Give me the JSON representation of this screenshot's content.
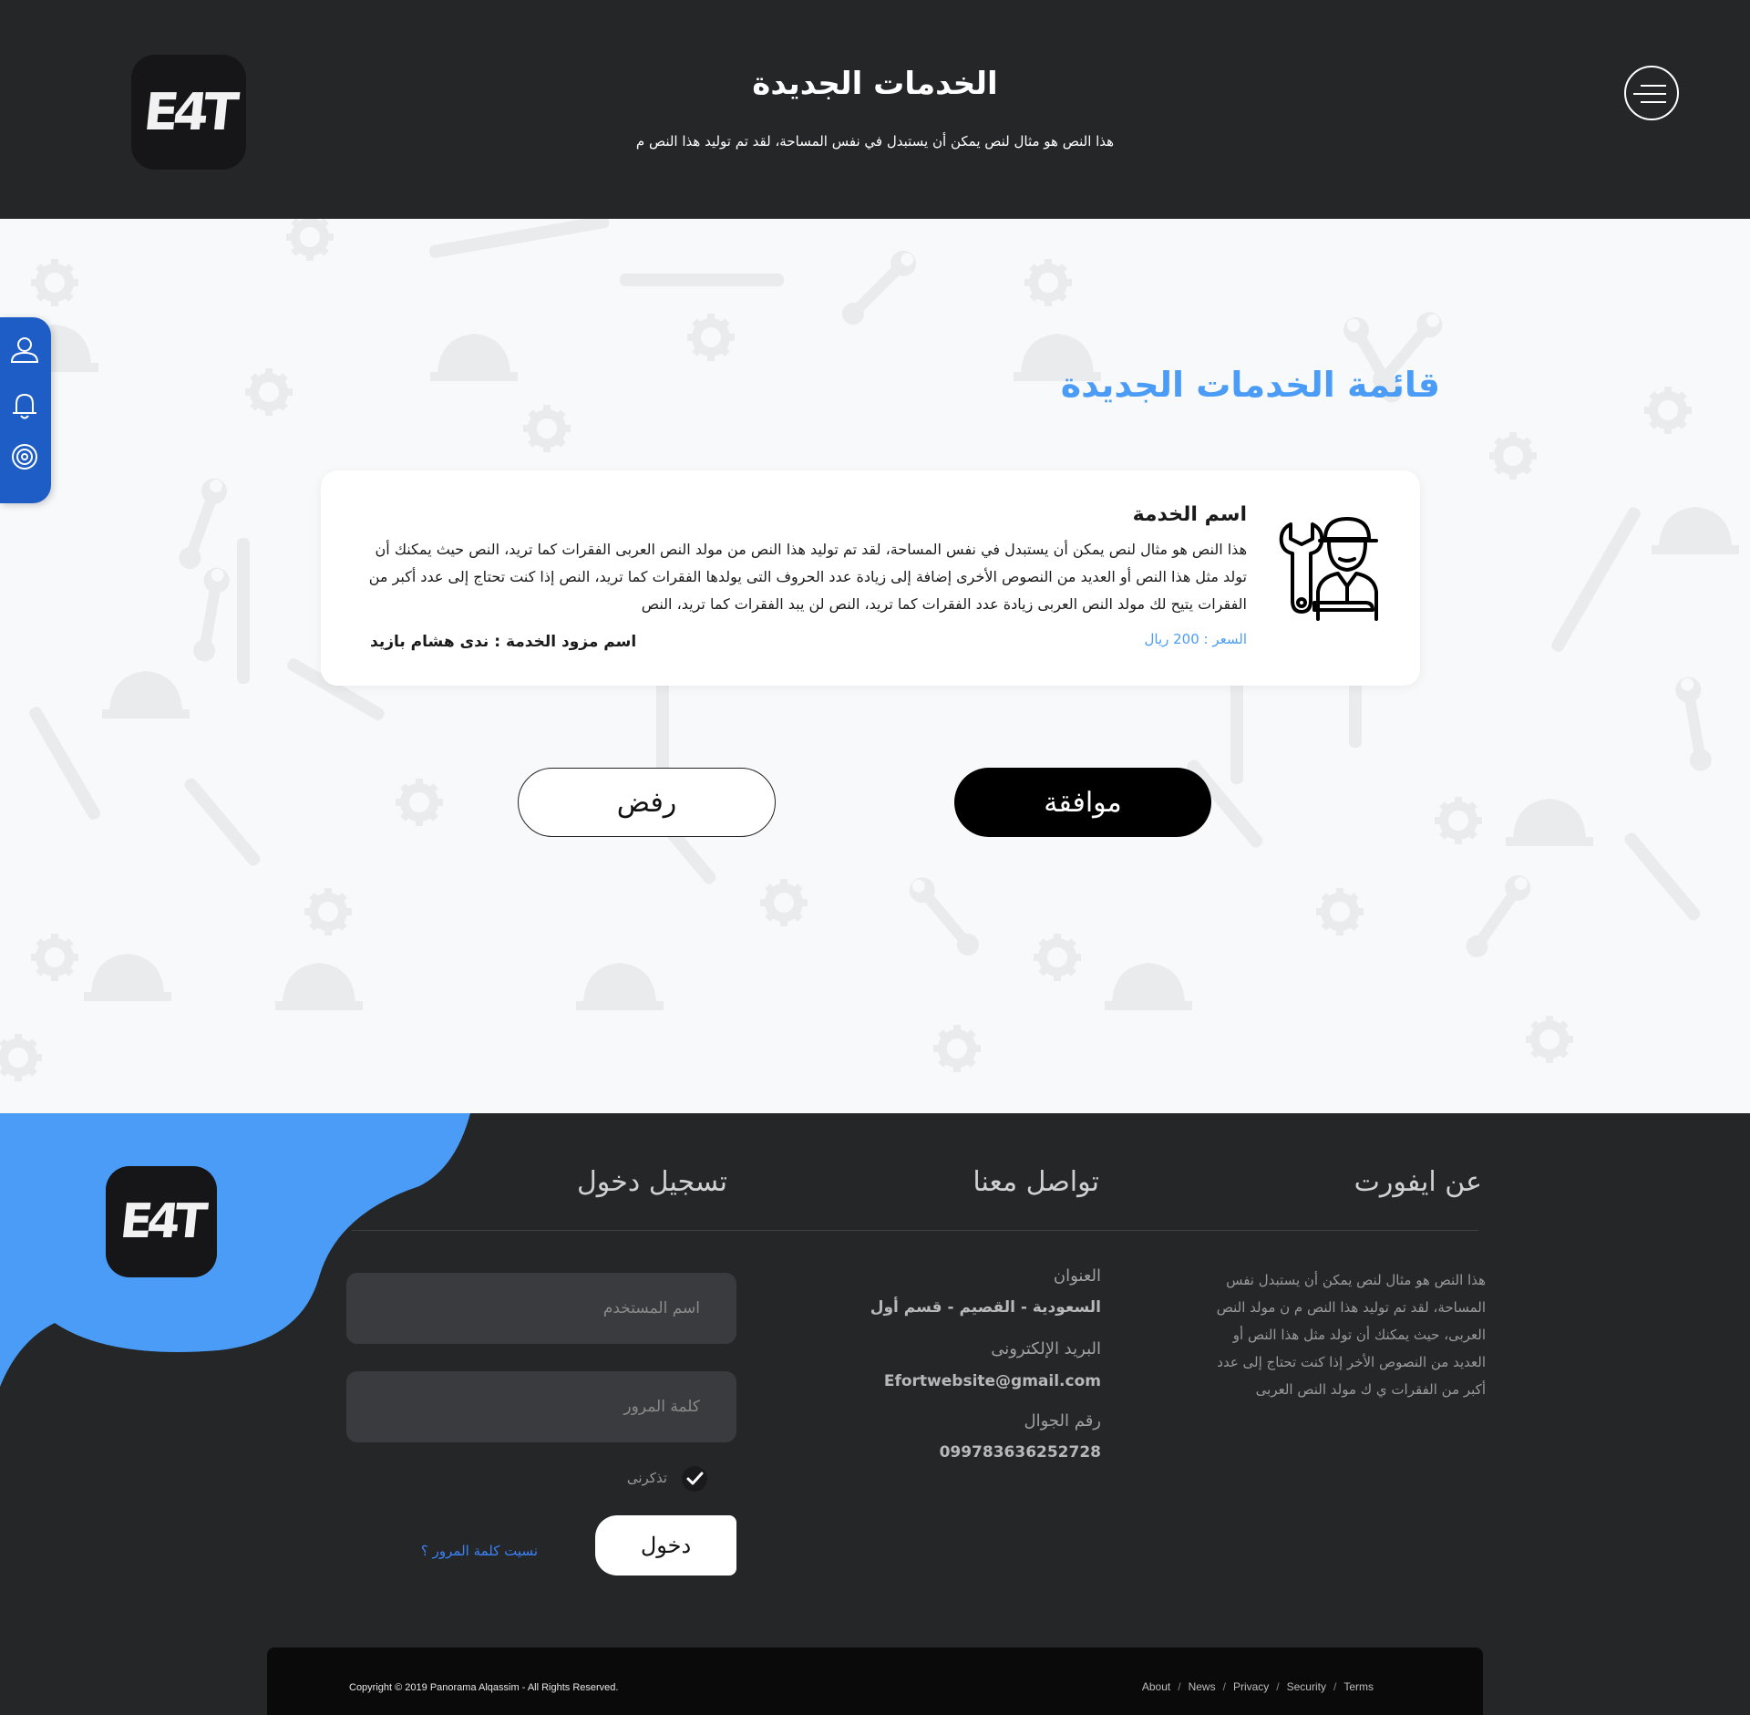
{
  "header": {
    "logo": "E4T",
    "title": "الخدمات الجديدة",
    "subtitle": "هذا النص هو مثال لنص يمكن أن يستبدل في نفس المساحة، لقد تم توليد هذا النص م"
  },
  "main": {
    "list_title": "قائمة الخدمات الجديدة",
    "service": {
      "name": "اسم الخدمة",
      "description": "هذا النص هو مثال لنص يمكن أن يستبدل في نفس المساحة، لقد تم توليد هذا النص من مولد النص العربى  الفقرات كما تريد، النص حيث يمكنك أن تولد مثل هذا النص أو العديد من النصوص الأخرى إضافة إلى زيادة عدد الحروف التى يولدها  الفقرات كما تريد، النص إذا كنت تحتاج إلى عدد أكبر من الفقرات يتيح لك مولد النص العربى زيادة عدد الفقرات كما تريد، النص لن يبد  الفقرات كما تريد، النص",
      "price": "السعر : 200 ريال",
      "provider": "اسم مزود الخدمة : ندى هشام بازيد"
    },
    "accept_label": "موافقة",
    "reject_label": "رفض"
  },
  "footer": {
    "logo": "E4T",
    "about": {
      "title": "عن ايفورت",
      "text": "هذا النص هو مثال لنص يمكن أن يستبدل نفس المساحة، لقد تم توليد هذا النص م ن مولد النص العربى، حيث يمكنك أن تولد مثل هذا النص أو العديد من النصوص الأخر إذا كنت تحتاج إلى عدد أكبر من الفقرات ي ك مولد النص العربى"
    },
    "contact": {
      "title": "تواصل معنا",
      "address_label": "العنوان",
      "address_value": "السعودية - القصيم - قسم أول",
      "email_label": "البريد الإلكترونى",
      "email_value": "Efortwebsite@gmail.com",
      "phone_label": "رقم الجوال",
      "phone_value": "099783636252728"
    },
    "login": {
      "title": "تسجيل دخول",
      "username_placeholder": "اسم المستخدم",
      "password_placeholder": "كلمة المرور",
      "remember_label": "تذكرنى",
      "submit_label": "دخول",
      "forgot_label": "نسيت كلمة المرور ؟"
    },
    "copyright": "Copyright © 2019  Panorama Alqassim -  All Rights Reserved.",
    "links": [
      "About",
      "News",
      "Privacy",
      "Security",
      "Terms"
    ]
  },
  "colors": {
    "accent": "#4a9cf6",
    "sidebar": "#1e5cc6",
    "dark": "#252628"
  }
}
